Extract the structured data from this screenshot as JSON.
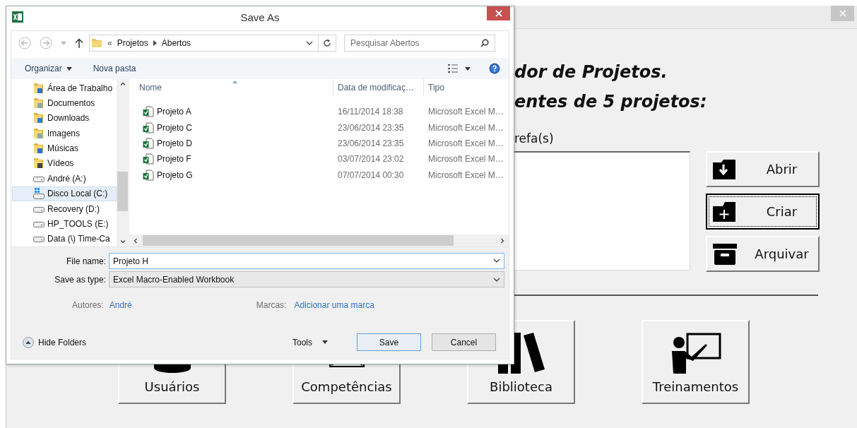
{
  "background_form": {
    "heading_lines": [
      "dor de Projetos.",
      "entes de 5 projetos:"
    ],
    "list_label": "refa(s)",
    "side_buttons": [
      {
        "label": "Abrir",
        "kind": "open",
        "focused": false
      },
      {
        "label": "Criar",
        "kind": "create",
        "focused": true
      },
      {
        "label": "Arquivar",
        "kind": "archive",
        "focused": false
      }
    ],
    "module_buttons": [
      {
        "label": "Usuários",
        "kind": "users"
      },
      {
        "label": "Competências",
        "kind": "skills"
      },
      {
        "label": "Biblioteca",
        "kind": "library"
      },
      {
        "label": "Treinamentos",
        "kind": "training"
      }
    ]
  },
  "dialog": {
    "title": "Save As",
    "address": {
      "overflow_marker": "«",
      "path": [
        "Projetos",
        "Abertos"
      ]
    },
    "search": {
      "placeholder": "Pesquisar Abertos"
    },
    "toolbar": {
      "organize": "Organizar",
      "new_folder": "Nova pasta"
    },
    "nav_items": [
      {
        "label": "Área de Trabalho",
        "kind": "desktop",
        "selected": false
      },
      {
        "label": "Documentos",
        "kind": "folder",
        "selected": false
      },
      {
        "label": "Downloads",
        "kind": "downloads",
        "selected": false
      },
      {
        "label": "Imagens",
        "kind": "folder",
        "selected": false
      },
      {
        "label": "Músicas",
        "kind": "music",
        "selected": false
      },
      {
        "label": "Vídeos",
        "kind": "video",
        "selected": false
      },
      {
        "label": "André (A:)",
        "kind": "drive",
        "selected": false
      },
      {
        "label": "Disco Local (C:)",
        "kind": "system-drive",
        "selected": true
      },
      {
        "label": "Recovery (D:)",
        "kind": "drive",
        "selected": false
      },
      {
        "label": "HP_TOOLS (E:)",
        "kind": "drive",
        "selected": false
      },
      {
        "label": "Data (\\) Time-Ca",
        "kind": "drive",
        "selected": false
      }
    ],
    "columns": [
      "Nome",
      "Data de modificaç…",
      "Tipo"
    ],
    "files": [
      {
        "name": "Projeto A",
        "modified": "16/11/2014 18:38",
        "type": "Microsoft Excel M…"
      },
      {
        "name": "Projeto C",
        "modified": "23/06/2014 23:35",
        "type": "Microsoft Excel M…"
      },
      {
        "name": "Projeto D",
        "modified": "23/06/2014 23:35",
        "type": "Microsoft Excel M…"
      },
      {
        "name": "Projeto F",
        "modified": "03/07/2014 23:02",
        "type": "Microsoft Excel M…"
      },
      {
        "name": "Projeto G",
        "modified": "07/07/2014 00:30",
        "type": "Microsoft Excel M…"
      }
    ],
    "file_name": {
      "label": "File name:",
      "value": "Projeto H"
    },
    "save_as_type": {
      "label": "Save as type:",
      "value": "Excel Macro-Enabled Workbook"
    },
    "authors": {
      "label": "Autores:",
      "value": "André"
    },
    "tags": {
      "label": "Marcas:",
      "value": "Adicionar uma marca"
    },
    "hide_folders": "Hide Folders",
    "tools": "Tools",
    "buttons": [
      {
        "label": "Save",
        "default": true
      },
      {
        "label": "Cancel",
        "default": false
      }
    ]
  }
}
